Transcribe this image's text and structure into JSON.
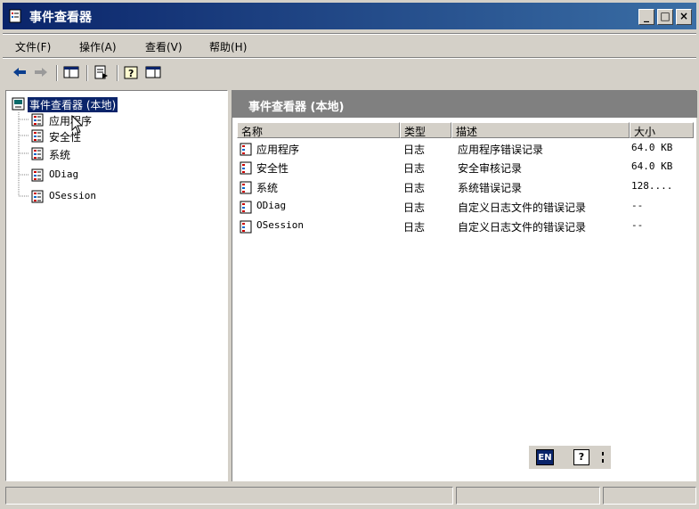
{
  "window": {
    "title": "事件查看器",
    "controls": [
      "_",
      "□",
      "×"
    ]
  },
  "menubar": {
    "items": [
      "文件(F)",
      "操作(A)",
      "查看(V)",
      "帮助(H)"
    ]
  },
  "tree": {
    "root": "事件查看器 (本地)",
    "children": [
      "应用程序",
      "安全性",
      "系统",
      "ODiag",
      "OSession"
    ]
  },
  "right_pane": {
    "header": "事件查看器 (本地)",
    "columns": [
      "名称",
      "类型",
      "描述",
      "大小"
    ],
    "rows": [
      {
        "name": "应用程序",
        "type": "日志",
        "desc": "应用程序错误记录",
        "size": "64.0 KB"
      },
      {
        "name": "安全性",
        "type": "日志",
        "desc": "安全审核记录",
        "size": "64.0 KB"
      },
      {
        "name": "系统",
        "type": "日志",
        "desc": "系统错误记录",
        "size": "128...."
      },
      {
        "name": "ODiag",
        "type": "日志",
        "desc": "自定义日志文件的错误记录",
        "size": "--"
      },
      {
        "name": "OSession",
        "type": "日志",
        "desc": "自定义日志文件的错误记录",
        "size": "--"
      }
    ]
  },
  "language_bar": {
    "lang": "EN",
    "help": "?"
  },
  "colors": {
    "title_start": "#0a246a",
    "title_end": "#3a6ea5",
    "chrome": "#d4d0c8",
    "selection": "#0a246a"
  }
}
